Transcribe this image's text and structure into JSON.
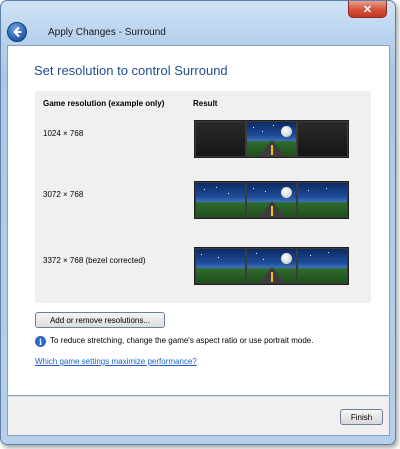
{
  "window": {
    "title": "Apply Changes - Surround",
    "close_glyph": "✕"
  },
  "main": {
    "heading": "Set resolution to control Surround",
    "table": {
      "col_resolution": "Game resolution (example only)",
      "col_result": "Result",
      "rows": [
        {
          "label": "1024 × 768",
          "screens": [
            "dark",
            "road",
            "dark"
          ]
        },
        {
          "label": "3072 × 768",
          "screens": [
            "road",
            "road",
            "road"
          ]
        },
        {
          "label": "3372 × 768 (bezel corrected)",
          "screens": [
            "road",
            "road",
            "road"
          ]
        }
      ]
    },
    "add_button": "Add or remove resolutions...",
    "info_icon": "i",
    "info_text": "To reduce stretching, change the game's aspect ratio or use portrait mode.",
    "link_text": "Which game settings maximize performance?"
  },
  "footer": {
    "finish_label": "Finish"
  },
  "colors": {
    "heading": "#1e4f8f",
    "link": "#1c5fbf",
    "close": "#c4361f"
  }
}
